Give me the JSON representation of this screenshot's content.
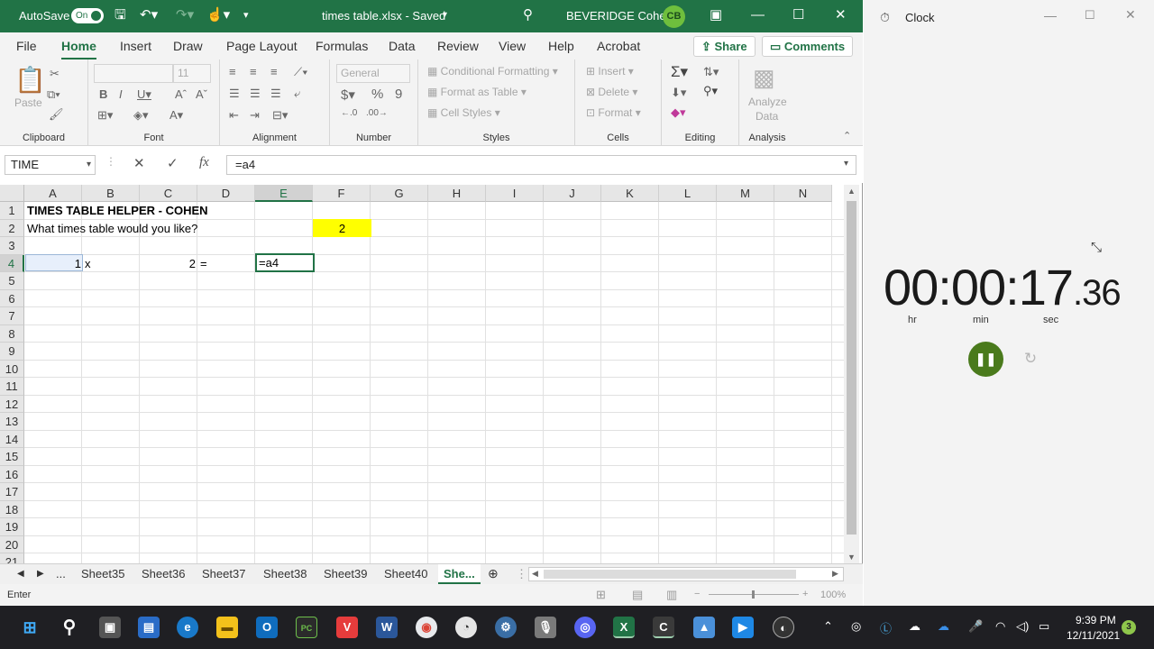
{
  "excel": {
    "autosave_label": "AutoSave",
    "autosave_state": "On",
    "file_title": "times table.xlsx - Saved",
    "user_name": "BEVERIDGE Cohen",
    "user_initials": "CB",
    "tabs": [
      "File",
      "Home",
      "Insert",
      "Draw",
      "Page Layout",
      "Formulas",
      "Data",
      "Review",
      "View",
      "Help",
      "Acrobat"
    ],
    "share_label": "Share",
    "comments_label": "Comments",
    "ribbon": {
      "clipboard": {
        "label": "Clipboard",
        "paste": "Paste"
      },
      "font": {
        "label": "Font",
        "size": "11"
      },
      "alignment": {
        "label": "Alignment"
      },
      "number": {
        "label": "Number",
        "format": "General"
      },
      "styles": {
        "label": "Styles",
        "conditional": "Conditional Formatting",
        "format_table": "Format as Table",
        "cell_styles": "Cell Styles"
      },
      "cells": {
        "label": "Cells",
        "insert": "Insert",
        "delete": "Delete",
        "format": "Format"
      },
      "editing": {
        "label": "Editing"
      },
      "analysis": {
        "label": "Analysis",
        "analyze": "Analyze",
        "data": "Data"
      }
    },
    "name_box": "TIME",
    "formula": "=a4",
    "columns": [
      "A",
      "B",
      "C",
      "D",
      "E",
      "F",
      "G",
      "H",
      "I",
      "J",
      "K",
      "L",
      "M",
      "N"
    ],
    "rows": [
      "1",
      "2",
      "3",
      "4",
      "5",
      "6",
      "7",
      "8",
      "9",
      "10",
      "11",
      "12",
      "13",
      "14",
      "15",
      "16",
      "17",
      "18",
      "19",
      "20",
      "21"
    ],
    "cells": {
      "A1": "TIMES TABLE HELPER - COHEN",
      "A2": "What times table would you like?",
      "F2": "2",
      "A4": "1",
      "B4": "x",
      "C4": "2",
      "D4": "=",
      "E4": "=a4"
    },
    "sheet_tabs": [
      "...",
      "Sheet35",
      "Sheet36",
      "Sheet37",
      "Sheet38",
      "Sheet39",
      "Sheet40",
      "She..."
    ],
    "status_mode": "Enter",
    "zoom": "100%"
  },
  "clock": {
    "title": "Clock",
    "hours": "00",
    "minutes": "00",
    "seconds": "17",
    "hundredths": ".36",
    "hr_label": "hr",
    "min_label": "min",
    "sec_label": "sec"
  },
  "taskbar": {
    "time": "9:39 PM",
    "date": "12/11/2021",
    "notifications": "3"
  },
  "colors": {
    "excel_green": "#217346",
    "highlight_yellow": "#ffff00",
    "pause_green": "#4a7a1c"
  }
}
